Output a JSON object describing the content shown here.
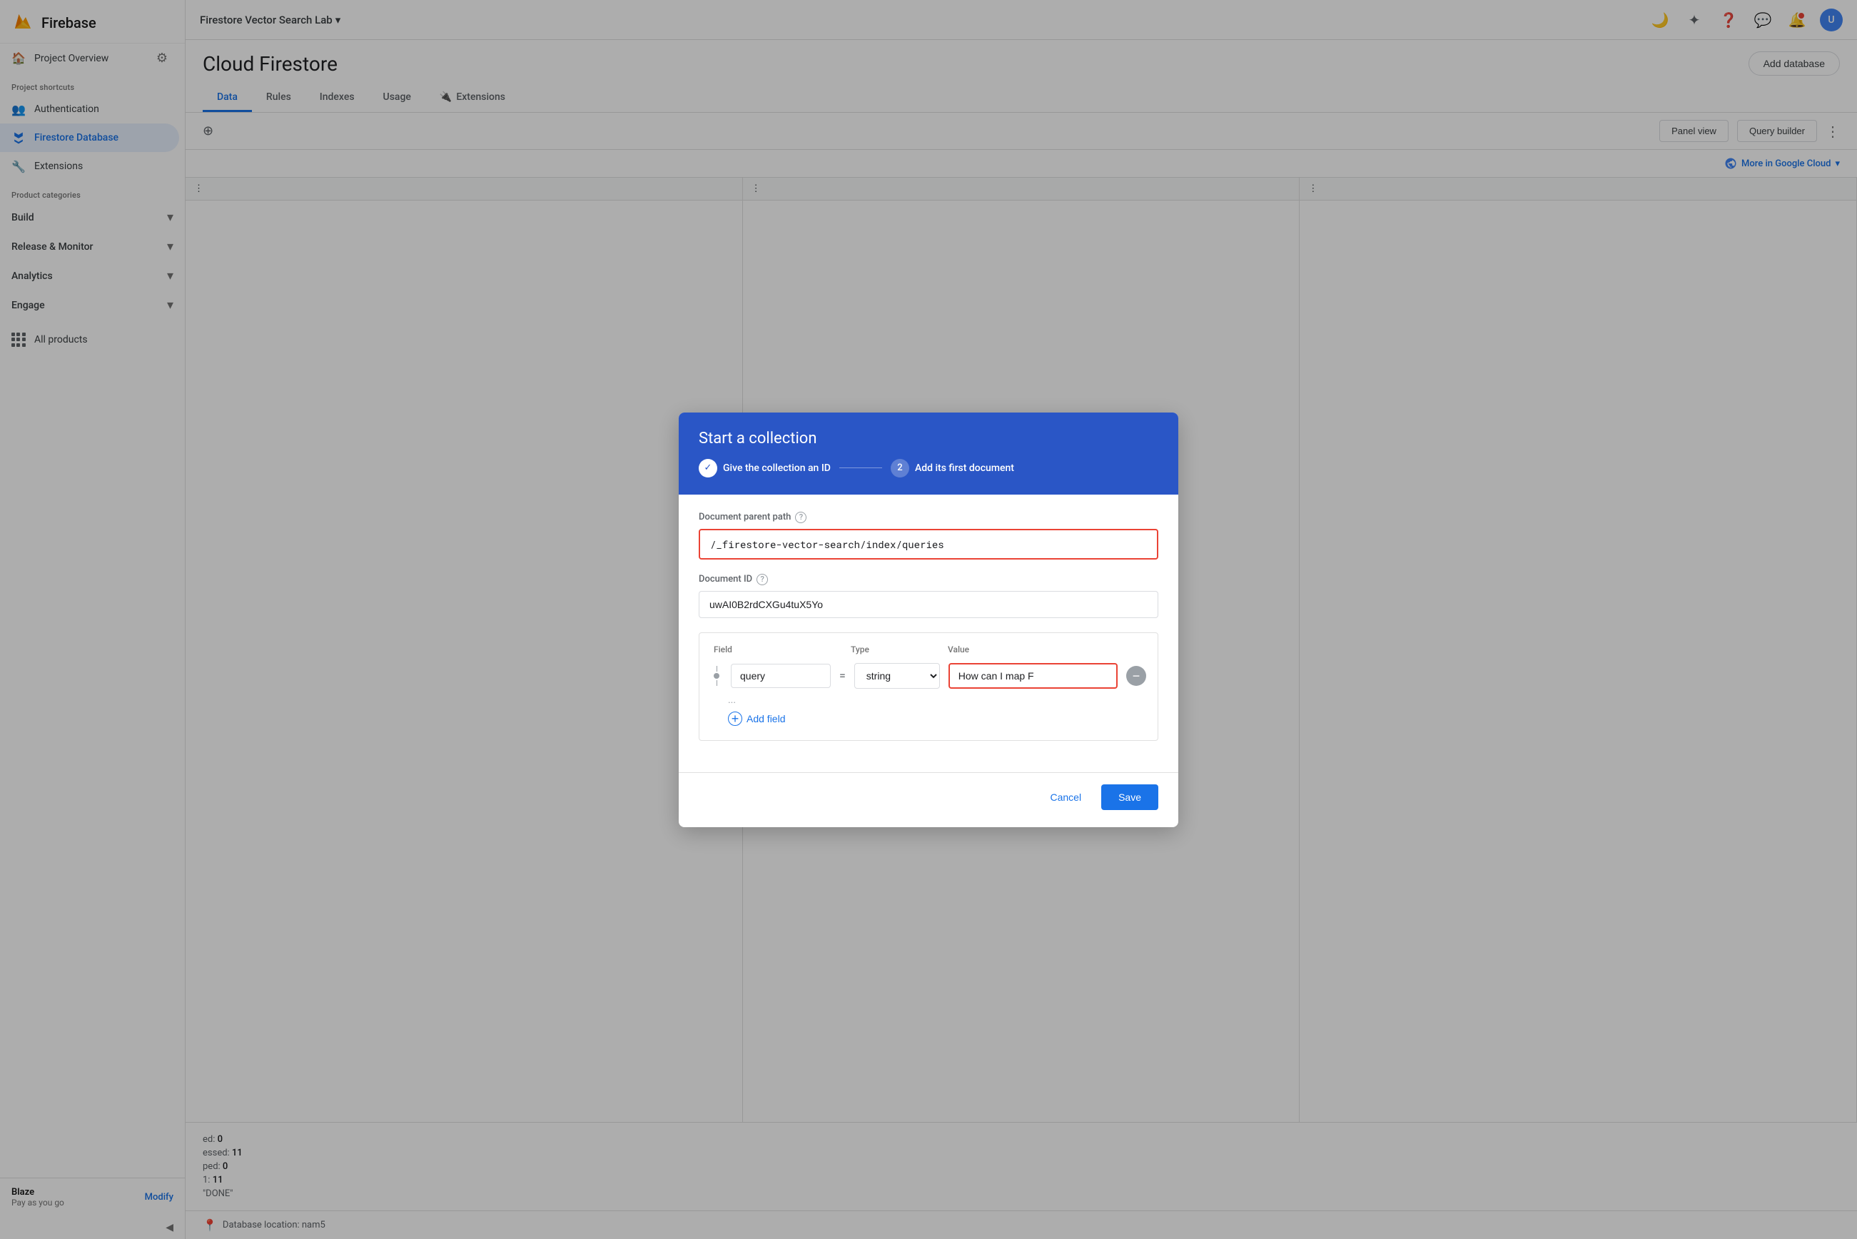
{
  "sidebar": {
    "logo": "Firebase",
    "project_shortcuts_label": "Project shortcuts",
    "authentication_label": "Authentication",
    "firestore_label": "Firestore Database",
    "extensions_label": "Extensions",
    "product_categories_label": "Product categories",
    "build_label": "Build",
    "release_monitor_label": "Release & Monitor",
    "analytics_label": "Analytics",
    "engage_label": "Engage",
    "all_products_label": "All products",
    "plan_name": "Blaze",
    "plan_sub": "Pay as you go",
    "modify_label": "Modify"
  },
  "topbar": {
    "project_name": "Firestore Vector Search Lab"
  },
  "page": {
    "title": "Cloud Firestore",
    "add_database_btn": "Add database",
    "tabs": [
      "Data",
      "Rules",
      "Indexes",
      "Usage",
      "Extensions"
    ],
    "active_tab": "Data"
  },
  "data_toolbar": {
    "panel_view": "Panel view",
    "query_builder": "Query builder",
    "more_in_cloud": "More in Google Cloud"
  },
  "bg_stats": {
    "stat1_label": "ed: 0",
    "stat2_label": "essed: 11",
    "stat3_label": "ped: 0",
    "stat4_label": "1: 11",
    "stat5_label": "\"DONE\""
  },
  "modal": {
    "title": "Start a collection",
    "step1_label": "Give the collection an ID",
    "step2_number": "2",
    "step2_label": "Add its first document",
    "doc_parent_path_label": "Document parent path",
    "doc_parent_path_value": "/_firestore-vector-search/index/queries",
    "doc_id_label": "Document ID",
    "doc_id_value": "uwAI0B2rdCXGu4tuX5Yo",
    "field_label": "Field",
    "type_label": "Type",
    "value_label": "Value",
    "field_name": "query",
    "field_type": "string",
    "field_value": "How can I map F",
    "add_field_label": "Add field",
    "cancel_label": "Cancel",
    "save_label": "Save"
  },
  "footer": {
    "db_location": "Database location: nam5"
  }
}
